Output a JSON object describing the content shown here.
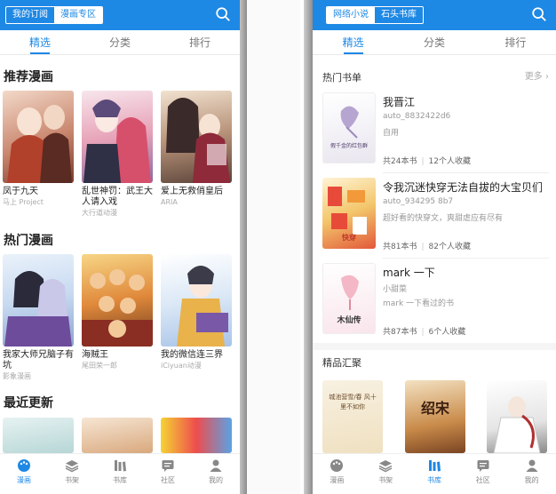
{
  "left": {
    "segments": [
      {
        "label": "我的订阅",
        "active": false
      },
      {
        "label": "漫画专区",
        "active": true
      }
    ],
    "tabs": [
      "精选",
      "分类",
      "排行"
    ],
    "sec1": "推荐漫画",
    "recommend": [
      {
        "title": "凤于九天",
        "sub": "马上 Project"
      },
      {
        "title": "乱世神罚：武王大人请入戏",
        "sub": "大行道动漫"
      },
      {
        "title": "爱上无救俏皇后",
        "sub": "ARIA"
      }
    ],
    "sec2": "热门漫画",
    "hot": [
      {
        "title": "我家大师兄脑子有坑",
        "sub": "影象漫画"
      },
      {
        "title": "海贼王",
        "sub": "尾田荣一郎"
      },
      {
        "title": "我的微信连三界",
        "sub": "iCiyuan动漫"
      }
    ],
    "sec3": "最近更新",
    "nav": [
      "漫画",
      "书架",
      "书库",
      "社区",
      "我的"
    ],
    "nav_active": 0
  },
  "right": {
    "segments": [
      {
        "label": "网络小说",
        "active": true
      },
      {
        "label": "石头书库",
        "active": false
      }
    ],
    "tabs": [
      "精选",
      "分类",
      "排行"
    ],
    "hot_title": "热门书单",
    "more": "更多",
    "booklists": [
      {
        "title": "我晋江",
        "user": "auto_8832422d6",
        "desc": "自用",
        "books": "共24本书",
        "fav": "12个人收藏",
        "cover_text": "假千金的红包群"
      },
      {
        "title": "令我沉迷快穿无法自拔的大宝贝们",
        "user": "auto_934295 8b7",
        "desc": "超好看的快穿文，爽甜虐应有尽有",
        "books": "共81本书",
        "fav": "82个人收藏",
        "cover_text": "快穿"
      },
      {
        "title": "mark 一下",
        "user": "小甜菜",
        "desc": "mark 一下看过的书",
        "books": "共87本书",
        "fav": "6个人收藏",
        "cover_text": "木仙传"
      }
    ],
    "collection_title": "精品汇聚",
    "collection_covers": [
      "城池营雪/春 风十里不如你",
      "绍宋",
      ""
    ],
    "nav": [
      "漫画",
      "书架",
      "书库",
      "社区",
      "我的"
    ],
    "nav_active": 2
  },
  "colors": {
    "accent": "#1e88e5",
    "bg": "#ffffff"
  }
}
